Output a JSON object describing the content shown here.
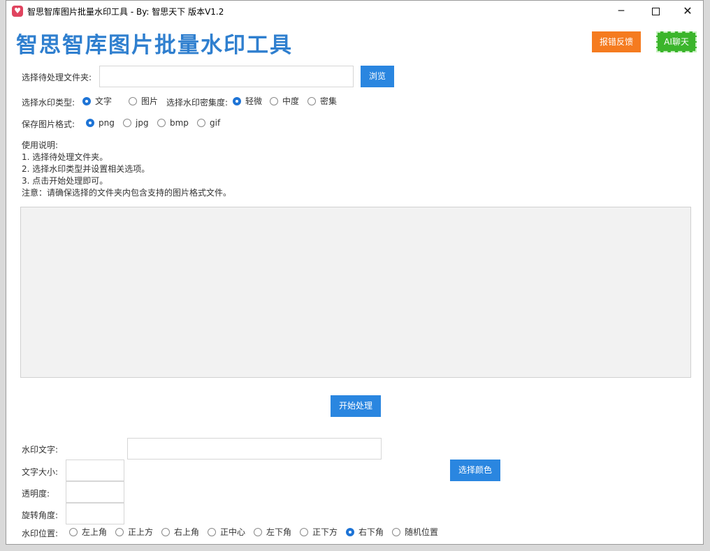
{
  "window": {
    "title": "智思智库图片批量水印工具 - By: 智思天下 版本V1.2",
    "app_icon": "heart-icon",
    "controls": {
      "minimize": "─",
      "close": "✕"
    }
  },
  "header": {
    "brand": "智思智库图片批量水印工具",
    "feedback_label": "报错反馈",
    "ai_label": "AI聊天"
  },
  "colors": {
    "brand": "#2f7fcf",
    "primary_button": "#2a86e0",
    "feedback_button": "#f57b1f",
    "ai_button": "#3bb52b",
    "radio_selected": "#1e74d6"
  },
  "folder": {
    "label": "选择待处理文件夹:",
    "value": "",
    "browse_label": "浏览"
  },
  "watermark_type": {
    "label": "选择水印类型:",
    "options": [
      {
        "label": "文字",
        "selected": true
      },
      {
        "label": "图片",
        "selected": false
      }
    ]
  },
  "density": {
    "label": "选择水印密集度:",
    "options": [
      {
        "label": "轻微",
        "selected": true
      },
      {
        "label": "中度",
        "selected": false
      },
      {
        "label": "密集",
        "selected": false
      }
    ]
  },
  "format": {
    "label": "保存图片格式:",
    "options": [
      {
        "label": "png",
        "selected": true
      },
      {
        "label": "jpg",
        "selected": false
      },
      {
        "label": "bmp",
        "selected": false
      },
      {
        "label": "gif",
        "selected": false
      }
    ]
  },
  "instructions": {
    "title": "使用说明:",
    "lines": [
      "1. 选择待处理文件夹。",
      "2. 选择水印类型并设置相关选项。",
      "3. 点击开始处理即可。",
      "注意：请确保选择的文件夹内包含支持的图片格式文件。"
    ]
  },
  "log": {
    "value": ""
  },
  "start_label": "开始处理",
  "text_settings": {
    "watermark_text_label": "水印文字:",
    "watermark_text_value": "",
    "font_size_label": "文字大小:",
    "font_size_value": "",
    "opacity_label": "透明度:",
    "opacity_value": "",
    "rotation_label": "旋转角度:",
    "rotation_value": "",
    "color_button_label": "选择颜色"
  },
  "position": {
    "label": "水印位置:",
    "options": [
      {
        "label": "左上角",
        "selected": false
      },
      {
        "label": "正上方",
        "selected": false
      },
      {
        "label": "右上角",
        "selected": false
      },
      {
        "label": "正中心",
        "selected": false
      },
      {
        "label": "左下角",
        "selected": false
      },
      {
        "label": "正下方",
        "selected": false
      },
      {
        "label": "右下角",
        "selected": true
      },
      {
        "label": "随机位置",
        "selected": false
      }
    ]
  }
}
